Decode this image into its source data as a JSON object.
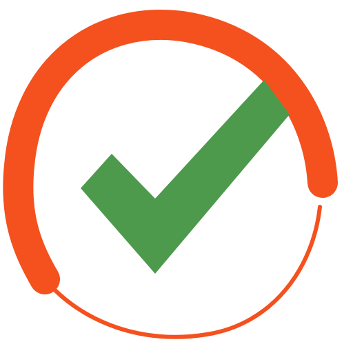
{
  "icon": {
    "name": "check-circle-progress-icon",
    "ring_color": "#F4511E",
    "check_color": "#4E9A4D",
    "background": "#FFFFFF"
  }
}
